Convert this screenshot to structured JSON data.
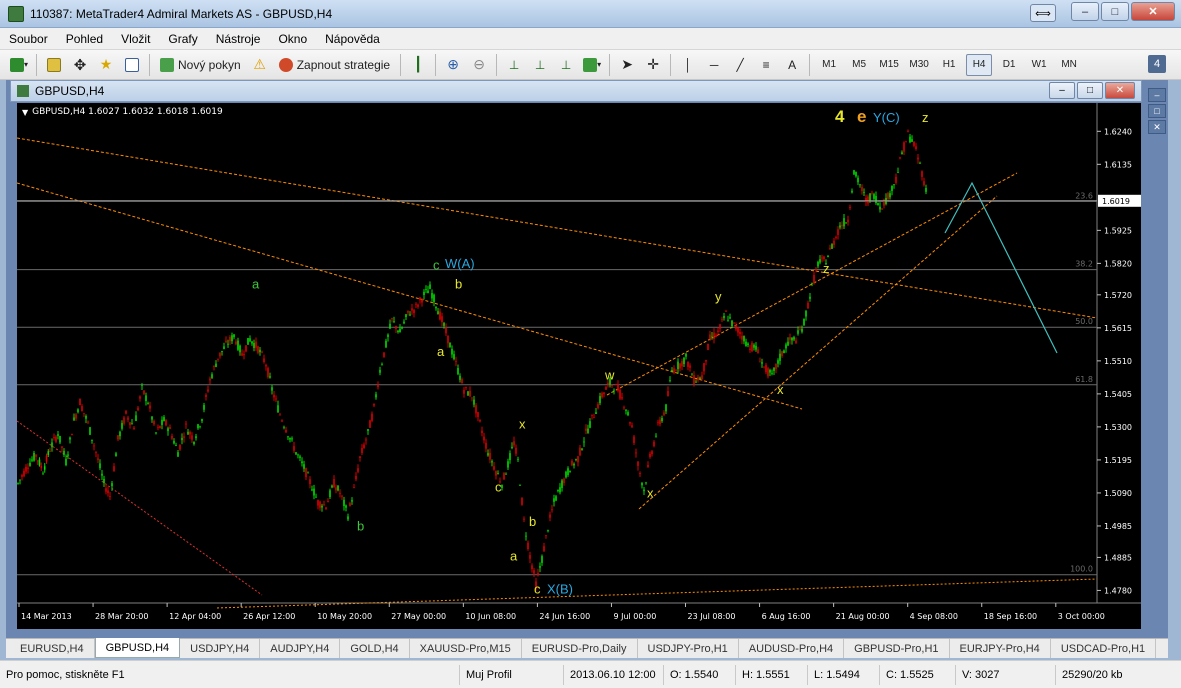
{
  "window": {
    "title": "110387: MetaTrader4 Admiral Markets AS - GBPUSD,H4",
    "minimize": "–",
    "maximize": "□",
    "close": "✕",
    "resize": "⟺"
  },
  "menu": [
    "Soubor",
    "Pohled",
    "Vložit",
    "Grafy",
    "Nástroje",
    "Okno",
    "Nápověda"
  ],
  "toolbar": {
    "new_order": "Nový pokyn",
    "start_strategy": "Zapnout strategie",
    "timeframes": [
      "M1",
      "M5",
      "M15",
      "M30",
      "H1",
      "H4",
      "D1",
      "W1",
      "MN"
    ],
    "active_timeframe": "H4",
    "text_tool": "A",
    "side_number": "4"
  },
  "chart_window": {
    "title": "GBPUSD,H4",
    "header": "GBPUSD,H4  1.6027 1.6032 1.6018 1.6019"
  },
  "chart_data": {
    "type": "candlestick",
    "symbol": "GBPUSD",
    "timeframe": "H4",
    "ohlc_last": {
      "open": 1.6027,
      "high": 1.6032,
      "low": 1.6018,
      "close": 1.6019
    },
    "current_price": "1.6019",
    "y_ticks": [
      "1.6240",
      "1.6135",
      "1.5925",
      "1.5820",
      "1.5720",
      "1.5615",
      "1.5510",
      "1.5405",
      "1.5300",
      "1.5195",
      "1.5090",
      "1.4985",
      "1.4885",
      "1.4780"
    ],
    "x_ticks": [
      "14 Mar 2013",
      "28 Mar 20:00",
      "12 Apr 04:00",
      "26 Apr 12:00",
      "10 May 20:00",
      "27 May 00:00",
      "10 Jun 08:00",
      "24 Jun 16:00",
      "9 Jul 00:00",
      "23 Jul 08:00",
      "6 Aug 16:00",
      "21 Aug 00:00",
      "4 Sep 08:00",
      "18 Sep 16:00",
      "3 Oct 00:00"
    ],
    "ylim": [
      1.474,
      1.633
    ],
    "price_path": [
      [
        0,
        1.512
      ],
      [
        10,
        1.518
      ],
      [
        18,
        1.521
      ],
      [
        25,
        1.516
      ],
      [
        32,
        1.523
      ],
      [
        40,
        1.528
      ],
      [
        48,
        1.519
      ],
      [
        56,
        1.532
      ],
      [
        62,
        1.538
      ],
      [
        70,
        1.531
      ],
      [
        78,
        1.522
      ],
      [
        86,
        1.512
      ],
      [
        92,
        1.508
      ],
      [
        100,
        1.526
      ],
      [
        108,
        1.534
      ],
      [
        116,
        1.53
      ],
      [
        124,
        1.542
      ],
      [
        130,
        1.538
      ],
      [
        138,
        1.528
      ],
      [
        146,
        1.532
      ],
      [
        152,
        1.529
      ],
      [
        160,
        1.522
      ],
      [
        168,
        1.53
      ],
      [
        176,
        1.526
      ],
      [
        184,
        1.533
      ],
      [
        192,
        1.545
      ],
      [
        200,
        1.552
      ],
      [
        208,
        1.556
      ],
      [
        216,
        1.559
      ],
      [
        224,
        1.553
      ],
      [
        232,
        1.558
      ],
      [
        240,
        1.555
      ],
      [
        248,
        1.55
      ],
      [
        254,
        1.542
      ],
      [
        262,
        1.534
      ],
      [
        270,
        1.528
      ],
      [
        278,
        1.522
      ],
      [
        286,
        1.517
      ],
      [
        294,
        1.511
      ],
      [
        300,
        1.506
      ],
      [
        308,
        1.505
      ],
      [
        316,
        1.512
      ],
      [
        322,
        1.509
      ],
      [
        330,
        1.502
      ],
      [
        336,
        1.51
      ],
      [
        342,
        1.52
      ],
      [
        350,
        1.528
      ],
      [
        356,
        1.536
      ],
      [
        362,
        1.548
      ],
      [
        368,
        1.556
      ],
      [
        374,
        1.564
      ],
      [
        382,
        1.56
      ],
      [
        390,
        1.566
      ],
      [
        398,
        1.568
      ],
      [
        406,
        1.572
      ],
      [
        412,
        1.574
      ],
      [
        418,
        1.569
      ],
      [
        426,
        1.562
      ],
      [
        432,
        1.556
      ],
      [
        440,
        1.548
      ],
      [
        446,
        1.542
      ],
      [
        454,
        1.54
      ],
      [
        462,
        1.531
      ],
      [
        470,
        1.522
      ],
      [
        478,
        1.516
      ],
      [
        484,
        1.512
      ],
      [
        490,
        1.518
      ],
      [
        496,
        1.525
      ],
      [
        500,
        1.519
      ],
      [
        506,
        1.5
      ],
      [
        512,
        1.489
      ],
      [
        518,
        1.48
      ],
      [
        524,
        1.488
      ],
      [
        530,
        1.498
      ],
      [
        536,
        1.506
      ],
      [
        544,
        1.512
      ],
      [
        552,
        1.517
      ],
      [
        560,
        1.52
      ],
      [
        568,
        1.528
      ],
      [
        576,
        1.534
      ],
      [
        584,
        1.54
      ],
      [
        592,
        1.544
      ],
      [
        600,
        1.542
      ],
      [
        608,
        1.536
      ],
      [
        614,
        1.53
      ],
      [
        620,
        1.518
      ],
      [
        626,
        1.51
      ],
      [
        632,
        1.52
      ],
      [
        640,
        1.53
      ],
      [
        648,
        1.536
      ],
      [
        654,
        1.548
      ],
      [
        662,
        1.55
      ],
      [
        668,
        1.552
      ],
      [
        676,
        1.545
      ],
      [
        684,
        1.546
      ],
      [
        692,
        1.558
      ],
      [
        700,
        1.56
      ],
      [
        708,
        1.566
      ],
      [
        714,
        1.563
      ],
      [
        722,
        1.56
      ],
      [
        730,
        1.556
      ],
      [
        738,
        1.555
      ],
      [
        746,
        1.549
      ],
      [
        754,
        1.546
      ],
      [
        762,
        1.552
      ],
      [
        770,
        1.557
      ],
      [
        778,
        1.558
      ],
      [
        786,
        1.563
      ],
      [
        792,
        1.572
      ],
      [
        800,
        1.582
      ],
      [
        808,
        1.583
      ],
      [
        816,
        1.589
      ],
      [
        822,
        1.594
      ],
      [
        830,
        1.596
      ],
      [
        836,
        1.611
      ],
      [
        842,
        1.607
      ],
      [
        848,
        1.602
      ],
      [
        856,
        1.604
      ],
      [
        862,
        1.6
      ],
      [
        870,
        1.603
      ],
      [
        878,
        1.609
      ],
      [
        884,
        1.617
      ],
      [
        890,
        1.623
      ],
      [
        896,
        1.62
      ],
      [
        904,
        1.611
      ],
      [
        910,
        1.602
      ]
    ],
    "reference_levels": [
      {
        "label": "23.6",
        "price": 1.6017
      },
      {
        "label": "38.2",
        "price": 1.58
      },
      {
        "label": "50.0",
        "price": 1.5617
      },
      {
        "label": "61.8",
        "price": 1.5434
      },
      {
        "label": "100.0",
        "price": 1.483
      }
    ],
    "wave_labels": [
      {
        "text": "a",
        "color": "#3cc83c",
        "x": 235,
        "price": 1.574
      },
      {
        "text": "b",
        "color": "#3cc83c",
        "x": 340,
        "price": 1.497
      },
      {
        "text": "c",
        "color": "#3cc83c",
        "x": 416,
        "price": 1.58
      },
      {
        "text": "W(A)",
        "color": "#2aa8e0",
        "x": 428,
        "price": 1.5805
      },
      {
        "text": "b",
        "color": "#e6e62a",
        "x": 438,
        "price": 1.574
      },
      {
        "text": "a",
        "color": "#e6e62a",
        "x": 420,
        "price": 1.5525
      },
      {
        "text": "x",
        "color": "#e6e62a",
        "x": 502,
        "price": 1.5295
      },
      {
        "text": "c",
        "color": "#e6e62a",
        "x": 478,
        "price": 1.5095
      },
      {
        "text": "b",
        "color": "#e6e62a",
        "x": 512,
        "price": 1.4985
      },
      {
        "text": "a",
        "color": "#e6e62a",
        "x": 493,
        "price": 1.4875
      },
      {
        "text": "c",
        "color": "#e6e62a",
        "x": 517,
        "price": 1.477
      },
      {
        "text": "X(B)",
        "color": "#2aa8e0",
        "x": 530,
        "price": 1.477
      },
      {
        "text": "w",
        "color": "#e6e62a",
        "x": 588,
        "price": 1.545
      },
      {
        "text": "x",
        "color": "#e6e62a",
        "x": 630,
        "price": 1.5075
      },
      {
        "text": "y",
        "color": "#e6e62a",
        "x": 698,
        "price": 1.57
      },
      {
        "text": "x",
        "color": "#e6e62a",
        "x": 760,
        "price": 1.5405
      },
      {
        "text": "z",
        "color": "#e6e62a",
        "x": 806,
        "price": 1.579
      },
      {
        "text": "4",
        "color": "#e6e62a",
        "x": 818,
        "price": 1.627
      },
      {
        "text": "e",
        "color": "#f0a020",
        "x": 840,
        "price": 1.627
      },
      {
        "text": "Y(C)",
        "color": "#2aa8e0",
        "x": 856,
        "price": 1.627
      },
      {
        "text": "z",
        "color": "#e6e62a",
        "x": 905,
        "price": 1.627
      }
    ]
  },
  "tabs": [
    "EURUSD,H4",
    "GBPUSD,H4",
    "USDJPY,H4",
    "AUDJPY,H4",
    "GOLD,H4",
    "XAUUSD-Pro,M15",
    "EURUSD-Pro,Daily",
    "USDJPY-Pro,H1",
    "AUDUSD-Pro,H4",
    "GBPUSD-Pro,H1",
    "EURJPY-Pro,H4",
    "USDCAD-Pro,H1"
  ],
  "active_tab": "GBPUSD,H4",
  "status": {
    "help": "Pro pomoc, stiskněte F1",
    "profile": "Muj Profil",
    "datetime": "2013.06.10 12:00",
    "open": "O: 1.5540",
    "high": "H: 1.5551",
    "low": "L: 1.5494",
    "close": "C: 1.5525",
    "volume": "V: 3027",
    "traffic": "25290/20 kb"
  },
  "colors": {
    "bull": "#00e000",
    "bear": "#e00000",
    "background": "#000000",
    "grid": "#808080",
    "fib": "#6a6a6a",
    "trend": "#ff8c00",
    "projection": "#40c0c0"
  }
}
